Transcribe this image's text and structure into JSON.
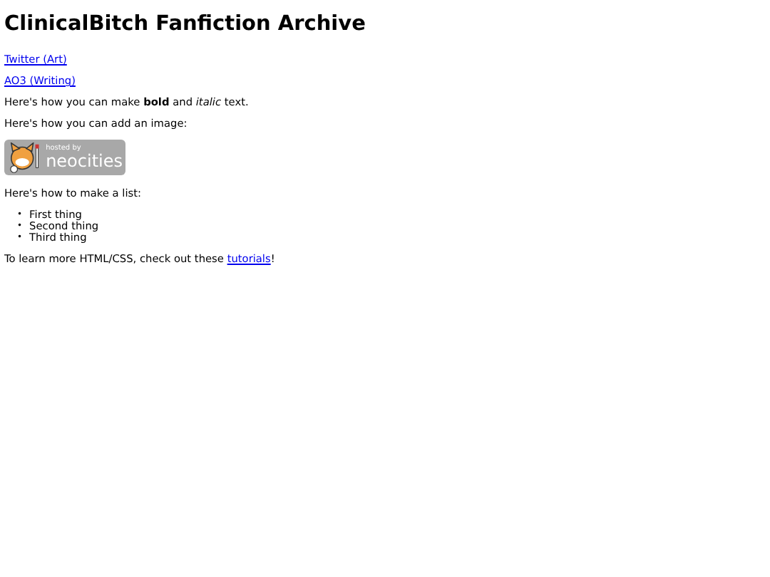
{
  "title": "ClinicalBitch Fanfiction Archive",
  "links": [
    "Twitter (Art)",
    "AO3 (Writing)"
  ],
  "format_text": "Here's how you can make **bold** and *italic* text.",
  "image_text": "Here's how you can add an image:",
  "badge": {
    "small": "hosted by",
    "large": "neocities"
  },
  "list_text": "Here's how to make a list:",
  "list": [
    {
      "marker": "•",
      "text": "First thing"
    },
    {
      "marker": "•",
      "text": "Second thing"
    },
    {
      "marker": "•",
      "text": "Third thing"
    }
  ],
  "footer": {
    "before": "To learn more HTML/CSS, check out these ",
    "link": "tutorials",
    "after": "!"
  }
}
